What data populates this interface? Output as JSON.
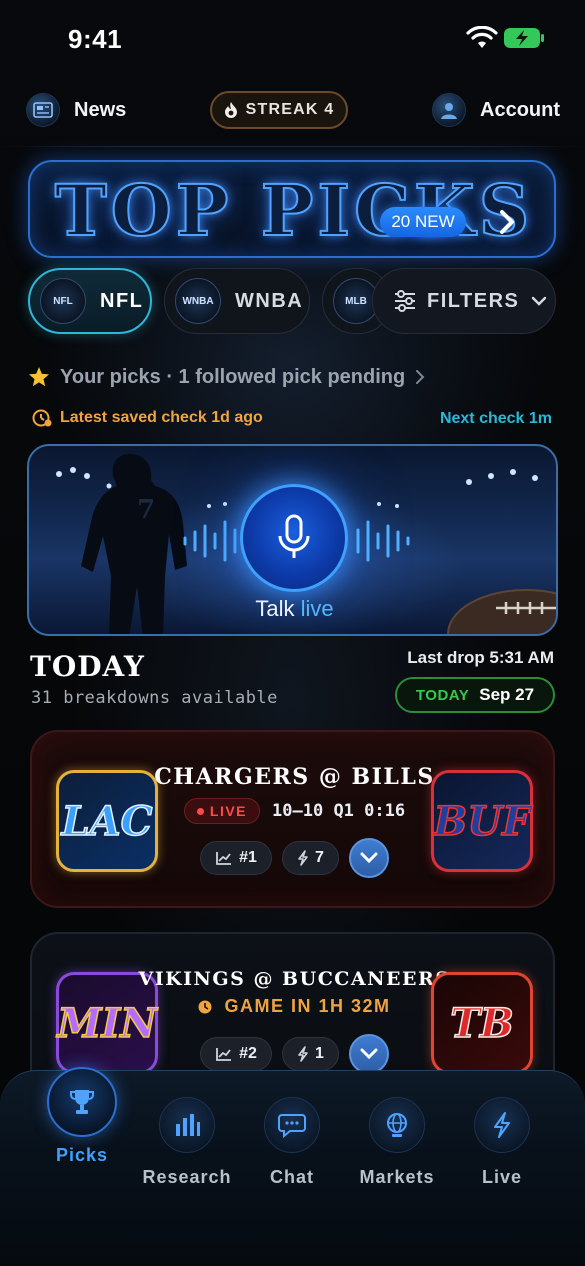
{
  "status_bar": {
    "time": "9:41"
  },
  "header": {
    "news_label": "News",
    "streak_label": "STREAK 4",
    "account_label": "Account"
  },
  "banner": {
    "title": "TOP PICKS",
    "new_badge": "20 NEW"
  },
  "leagues": {
    "chips": [
      {
        "label": "NFL",
        "logo": "NFL",
        "active": true
      },
      {
        "label": "WNBA",
        "logo": "WNBA",
        "active": false
      },
      {
        "label": "",
        "logo": "MLB",
        "active": false
      }
    ],
    "filters_label": "FILTERS"
  },
  "your_picks": {
    "text": "Your picks · 1 followed pick pending"
  },
  "check": {
    "latest": "Latest saved check 1d ago",
    "next": "Next check 1m"
  },
  "talk_live": {
    "prefix": "Talk",
    "highlight": "live",
    "jersey": "7"
  },
  "today": {
    "title": "TODAY",
    "subtitle": "31 breakdowns available",
    "last_drop": "Last drop 5:31 AM",
    "date_tag": "TODAY",
    "date": "Sep 27"
  },
  "games": [
    {
      "matchup": "CHARGERS @ BILLS",
      "away": "LAC",
      "home": "BUF",
      "live_label": "LIVE",
      "score": "10–10 Q1 0:16",
      "rank": "#1",
      "edge": "7"
    },
    {
      "matchup": "VIKINGS @ BUCCANEERS",
      "away": "MIN",
      "home": "TB",
      "game_time": "GAME IN 1H 32M",
      "rank": "#2",
      "edge": "1"
    }
  ],
  "tabs": [
    {
      "label": "Picks",
      "icon": "trophy-icon",
      "active": true
    },
    {
      "label": "Research",
      "icon": "bar-chart-icon",
      "active": false
    },
    {
      "label": "Chat",
      "icon": "chat-bubble-icon",
      "active": false
    },
    {
      "label": "Markets",
      "icon": "globe-icon",
      "active": false
    },
    {
      "label": "Live",
      "icon": "lightning-icon",
      "active": false
    }
  ],
  "colors": {
    "accent_blue": "#3ea0ff",
    "accent_cyan": "#2bb8d6",
    "warning_orange": "#f0a341",
    "live_red": "#ff4a4a",
    "today_green": "#34c94f"
  }
}
